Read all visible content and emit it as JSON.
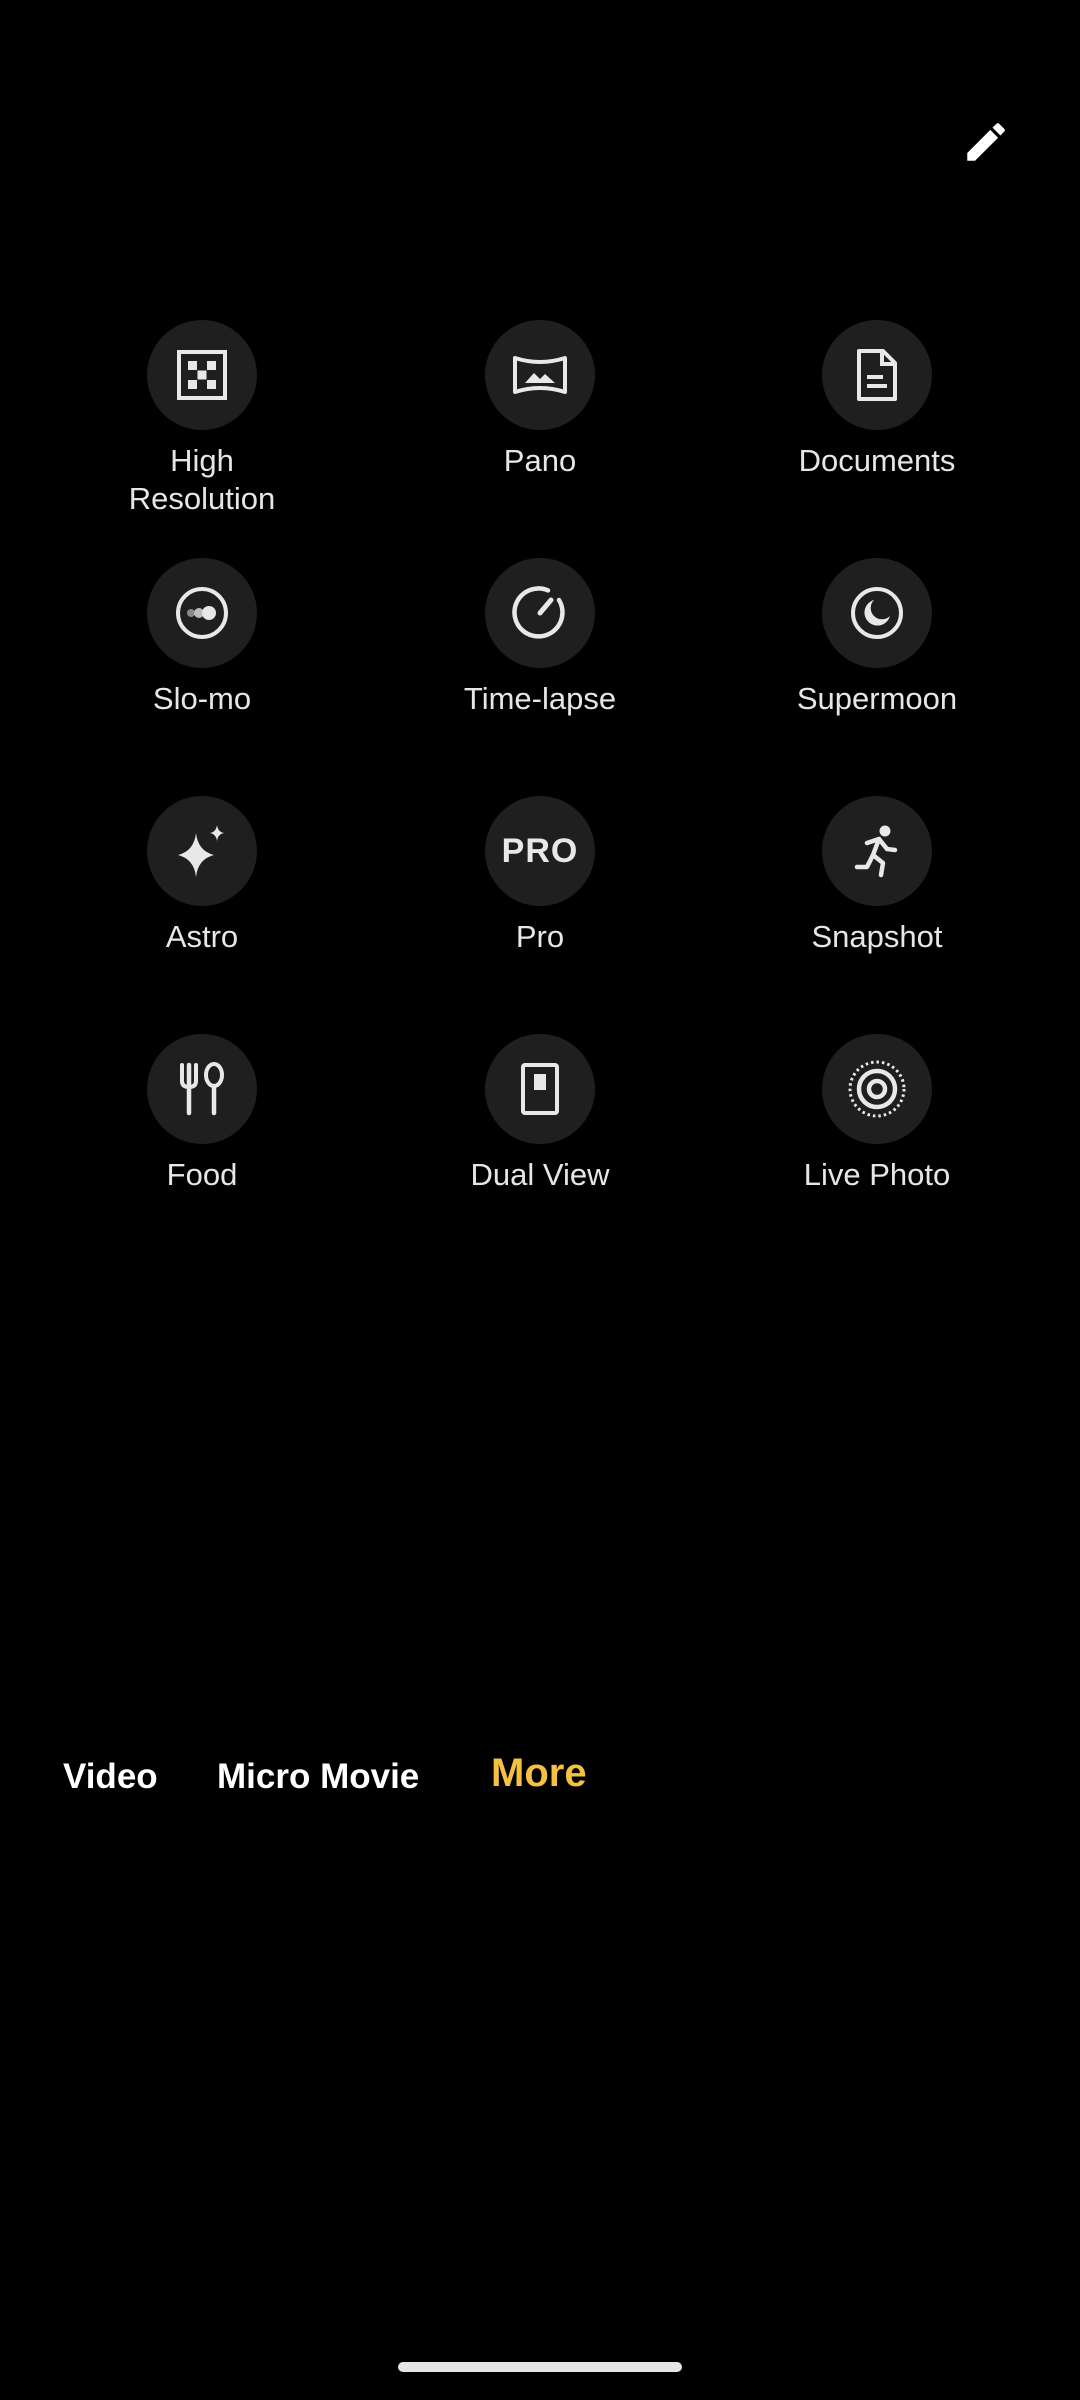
{
  "header": {
    "edit_icon": "pencil-icon"
  },
  "modes": [
    {
      "label": "High\nResolution",
      "icon": "high-resolution-icon"
    },
    {
      "label": "Pano",
      "icon": "panorama-icon"
    },
    {
      "label": "Documents",
      "icon": "document-icon"
    },
    {
      "label": "Slo-mo",
      "icon": "slow-motion-icon"
    },
    {
      "label": "Time-lapse",
      "icon": "timer-icon"
    },
    {
      "label": "Supermoon",
      "icon": "moon-icon"
    },
    {
      "label": "Astro",
      "icon": "sparkle-icon"
    },
    {
      "label": "Pro",
      "icon": "pro-icon",
      "icon_text": "PRO"
    },
    {
      "label": "Snapshot",
      "icon": "running-person-icon"
    },
    {
      "label": "Food",
      "icon": "fork-spoon-icon"
    },
    {
      "label": "Dual View",
      "icon": "dual-view-icon"
    },
    {
      "label": "Live Photo",
      "icon": "live-photo-icon"
    }
  ],
  "mode_bar": {
    "tabs": [
      {
        "label": "Video",
        "active": false
      },
      {
        "label": "Micro Movie",
        "active": false
      },
      {
        "label": "More",
        "active": true
      }
    ]
  },
  "colors": {
    "background": "#000000",
    "tile": "#1f1f1f",
    "accent": "#f5c142",
    "text": "#e6e6e6"
  }
}
